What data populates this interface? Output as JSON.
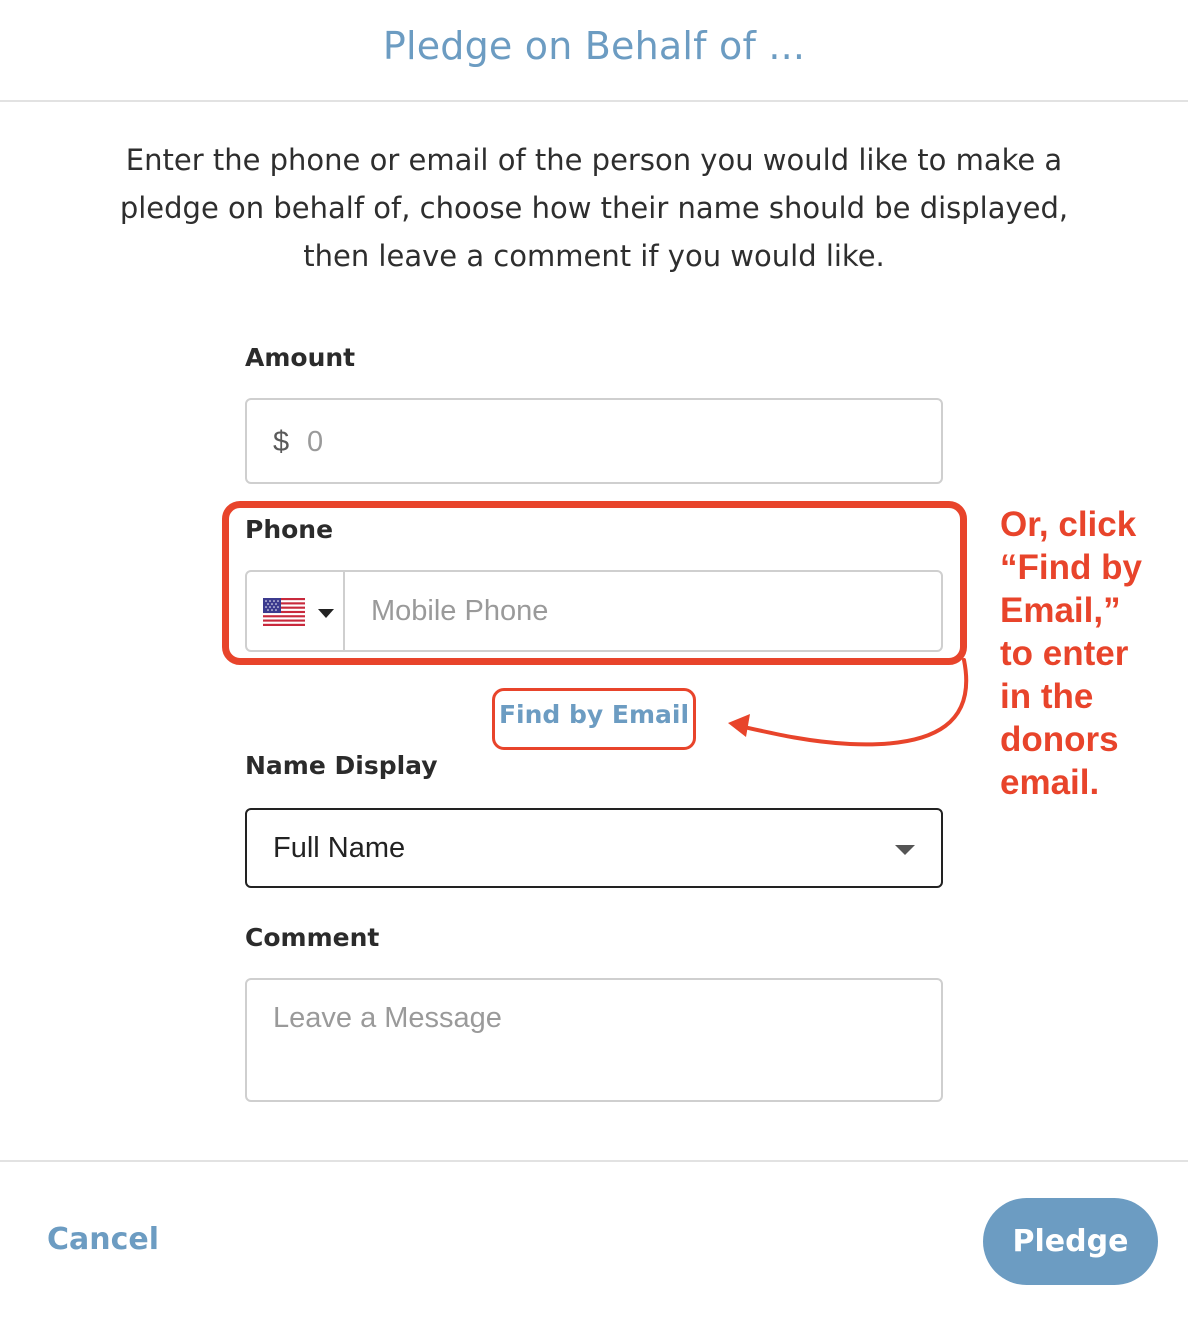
{
  "modal": {
    "title": "Pledge on Behalf of ...",
    "intro_line1": "Enter the phone or email of the person you would like to make a",
    "intro_line2": "pledge on behalf of, choose how their name should be displayed,",
    "intro_line3": "then leave a comment if you would like."
  },
  "form": {
    "amount": {
      "label": "Amount",
      "prefix": "$",
      "value": "0"
    },
    "phone": {
      "label": "Phone",
      "country": "US",
      "country_icon": "us-flag-icon",
      "placeholder": "Mobile Phone"
    },
    "find_by_email_label": "Find by Email",
    "name_display": {
      "label": "Name Display",
      "selected": "Full Name"
    },
    "comment": {
      "label": "Comment",
      "placeholder": "Leave a Message"
    }
  },
  "annotation": {
    "line1": "Or, click",
    "line2": "“Find by",
    "line3": "Email,”",
    "line4": "to enter",
    "line5": "in the",
    "line6": "donors",
    "line7": "email."
  },
  "footer": {
    "cancel_label": "Cancel",
    "pledge_label": "Pledge"
  },
  "colors": {
    "accent": "#6c9cc2",
    "annotation_red": "#e8442b",
    "border": "#cfcfcf"
  }
}
